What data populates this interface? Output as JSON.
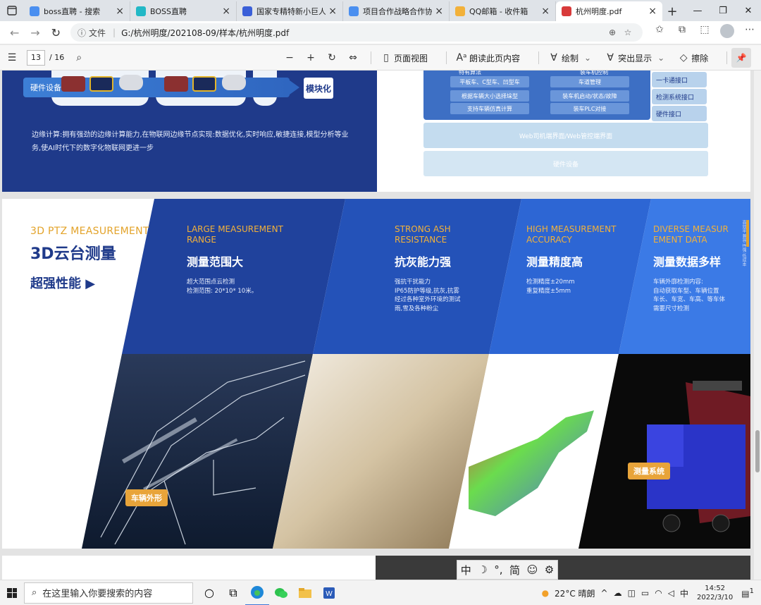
{
  "browser": {
    "tabs": [
      {
        "title": "boss直聘 - 搜索",
        "favicon": "search-icon",
        "color": "#4a8ff0",
        "active": false
      },
      {
        "title": "BOSS直聘",
        "favicon": "boss-icon",
        "color": "#22b8c6",
        "active": false
      },
      {
        "title": "国家专精特新小巨人，及申",
        "favicon": "baidu-icon",
        "color": "#3a5fd8",
        "active": false
      },
      {
        "title": "项目合作战略合作协议(战略",
        "favicon": "doc-icon",
        "color": "#4a8ff0",
        "active": false
      },
      {
        "title": "QQ邮箱 - 收件箱",
        "favicon": "qq-mail-icon",
        "color": "#f2b13a",
        "active": false
      },
      {
        "title": "杭州明度.pdf",
        "favicon": "pdf-icon",
        "color": "#d83a3a",
        "active": true
      }
    ],
    "new_tab_glyph": "+",
    "address": {
      "scheme_label": "文件",
      "path": "G:/杭州明度/202108-09/样本/杭州明度.pdf"
    }
  },
  "pdf_toolbar": {
    "page_current": "13",
    "page_total": "/ 16",
    "tools": {
      "page_view": "页面视图",
      "read_aloud": "朗读此页内容",
      "draw": "绘制",
      "highlight": "突出显示",
      "erase": "擦除"
    }
  },
  "page1": {
    "hw_label": "硬件设备",
    "modular": "模块化",
    "edge_text": "边缘计算:拥有强劲的边缘计算能力,在物联网边缘节点实现:数据优化,实时响应,敏捷连接,模型分析等业务,使AI时代下的数字化物联网更进一步",
    "arch": {
      "col1_head": "特有算法",
      "col2_head": "装车机控制",
      "col1": [
        "平板车、C型车、凹型车",
        "根据车辆大小选择垛型",
        "支持车辆仿真计算"
      ],
      "col2": [
        "车道管理",
        "装车机启动/状态/故障",
        "装车PLC对接"
      ],
      "side": [
        "一卡通接口",
        "检测系统接口",
        "硬件接口"
      ],
      "web": "Web司机端界面/Web管控端界面",
      "hw": "硬件设备"
    }
  },
  "page2": {
    "intro_en": "3D PTZ MEASUREMENT",
    "intro_cn": "3D云台测量",
    "intro_sub": "超强性能 ▶",
    "side_strip": "高效率 兼容 性强 低成本",
    "features": [
      {
        "en": "LARGE MEASUREMENT RANGE",
        "title": "测量范围大",
        "desc": "超大范围点云检测\n检测范围: 20*10* 10米。"
      },
      {
        "en": "STRONG ASH RESISTANCE",
        "title": "抗灰能力强",
        "desc": "强抗干扰能力\nIP65防护等级,抗灰,抗雾\n经过各种室外环境的测试\n雨,雪及各种粉尘"
      },
      {
        "en": "HIGH MEASUREMENT ACCURACY",
        "title": "测量精度高",
        "desc": "检测精度±20mm\n重复精度±5mm"
      },
      {
        "en": "DIVERSE MEASUR EMENT DATA",
        "title": "测量数据多样",
        "desc": "车辆外廓检测内容:\n自动获取车型、车辆位置\n车长、车宽、车高、等车体\n需要尺寸检测"
      }
    ],
    "tags": {
      "vehicle_outline": "车辆外形",
      "measure_system": "测量系统"
    }
  },
  "ime": {
    "mode": "中",
    "moon": "☽",
    "punct": "°,",
    "simplified": "简",
    "emoji": "☺",
    "settings": "⚙"
  },
  "taskbar": {
    "search_placeholder": "在这里输入你要搜索的内容",
    "weather": "22°C  晴朗",
    "ime_indicator": "中",
    "time": "14:52",
    "date": "2022/3/10",
    "notification_count": "1"
  }
}
